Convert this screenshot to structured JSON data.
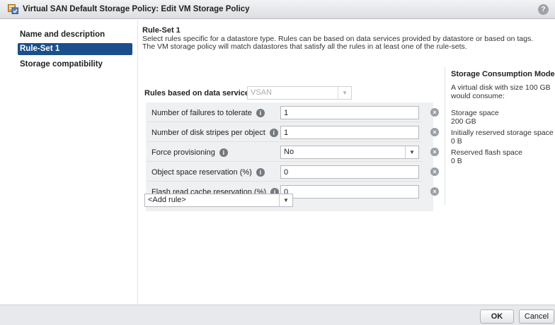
{
  "window": {
    "title": "Virtual SAN Default Storage Policy: Edit VM Storage Policy",
    "help_label": "?"
  },
  "nav": {
    "items": [
      {
        "label": "Name and description",
        "active": false
      },
      {
        "label": "Rule-Set 1",
        "active": true
      },
      {
        "label": "Storage compatibility",
        "active": false
      }
    ]
  },
  "ruleset": {
    "title": "Rule-Set 1",
    "description_line1": "Select rules specific for a datastore type. Rules can be based on data services provided by datastore or based on tags.",
    "description_line2": "The VM storage policy will match datastores that satisfy all the rules in at least one of the rule-sets.",
    "rules_label": "Rules based on data services",
    "data_service_value": "VSAN",
    "rules": [
      {
        "label": "Number of failures to tolerate",
        "value": "1",
        "type": "input"
      },
      {
        "label": "Number of disk stripes per object",
        "value": "1",
        "type": "input"
      },
      {
        "label": "Force provisioning",
        "value": "No",
        "type": "select"
      },
      {
        "label": "Object space reservation (%)",
        "value": "0",
        "type": "input"
      },
      {
        "label": "Flash read cache reservation (%)",
        "value": "0",
        "type": "input"
      }
    ],
    "add_rule_label": "<Add rule>"
  },
  "consumption": {
    "title": "Storage Consumption Model",
    "intro": "A virtual disk with size 100 GB would consume:",
    "storage_space_label": "Storage space",
    "storage_space_value": "200 GB",
    "initially_reserved_label": "Initially reserved storage space",
    "initially_reserved_value": "0 B",
    "reserved_flash_label": "Reserved flash space",
    "reserved_flash_value": "0 B"
  },
  "footer": {
    "ok_label": "OK",
    "cancel_label": "Cancel"
  },
  "icons": {
    "info_glyph": "i",
    "remove_glyph": "×",
    "dropdown_glyph": "▼"
  },
  "colors": {
    "accent": "#1a4f8b"
  }
}
